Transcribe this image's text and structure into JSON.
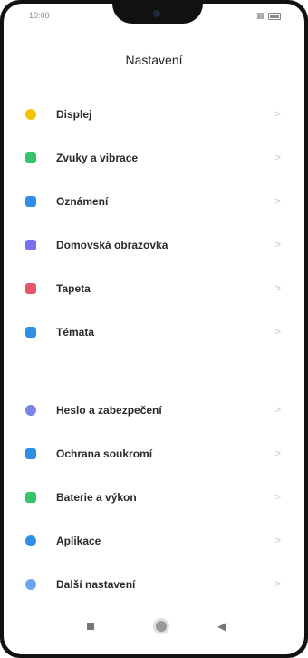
{
  "status": {
    "time": "10:00"
  },
  "header": {
    "title": "Nastavení"
  },
  "section1": [
    {
      "label": "Displej",
      "icon": "sun-icon",
      "color": "#f5c400"
    },
    {
      "label": "Zvuky a vibrace",
      "icon": "speaker-icon",
      "color": "#37c46b"
    },
    {
      "label": "Oznámení",
      "icon": "notification-icon",
      "color": "#2f8fe6"
    },
    {
      "label": "Domovská obrazovka",
      "icon": "home-icon",
      "color": "#7b6ff0"
    },
    {
      "label": "Tapeta",
      "icon": "wallpaper-icon",
      "color": "#e8566e"
    },
    {
      "label": "Témata",
      "icon": "themes-icon",
      "color": "#2f8fe6"
    }
  ],
  "section2": [
    {
      "label": "Heslo a zabezpečení",
      "icon": "lock-icon",
      "color": "#7b84e8"
    },
    {
      "label": "Ochrana soukromí",
      "icon": "privacy-icon",
      "color": "#2f8fe6"
    },
    {
      "label": "Baterie a výkon",
      "icon": "battery-icon",
      "color": "#37c46b"
    },
    {
      "label": "Aplikace",
      "icon": "gear-icon",
      "color": "#2f8fe6"
    },
    {
      "label": "Další nastavení",
      "icon": "more-icon",
      "color": "#6aa6f0"
    }
  ],
  "chevron": ">"
}
